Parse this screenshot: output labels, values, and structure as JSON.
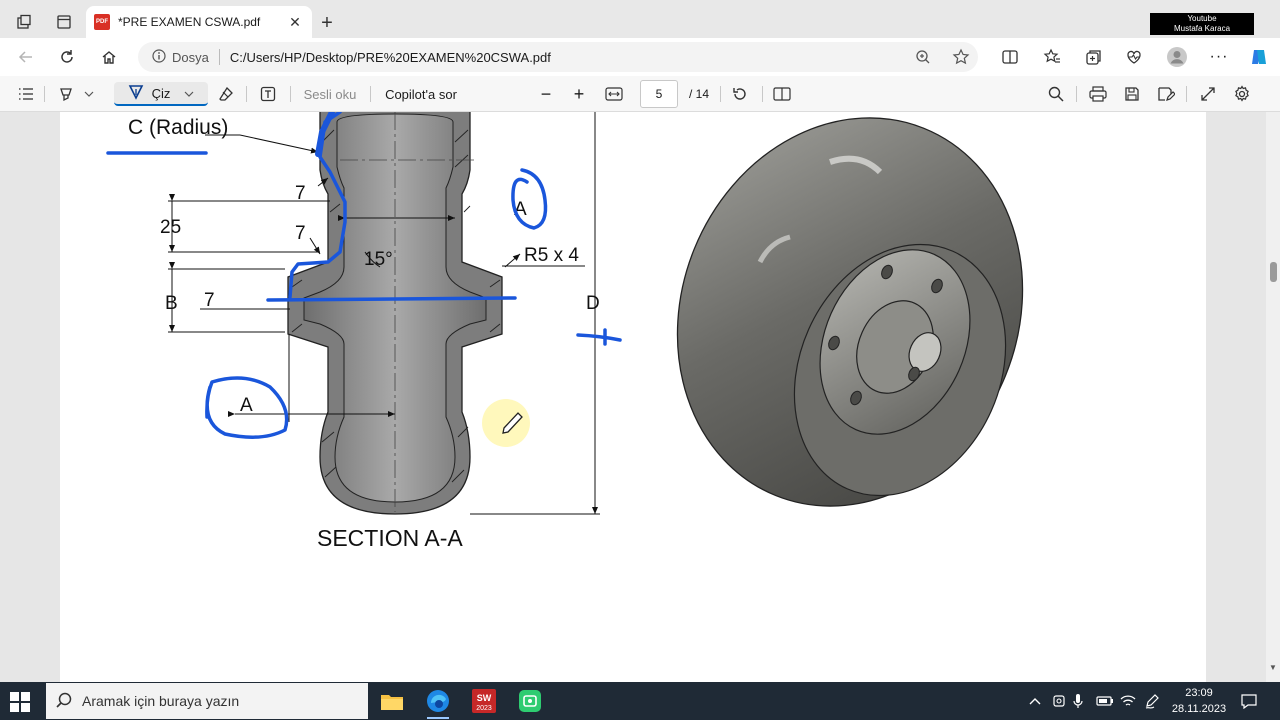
{
  "tab": {
    "title": "*PRE EXAMEN CSWA.pdf",
    "badge": "PDF"
  },
  "overlay": {
    "line1": "Youtube",
    "line2": "Mustafa Karaca"
  },
  "address": {
    "label": "Dosya",
    "url": "C:/Users/HP/Desktop/PRE%20EXAMEN%20CSWA.pdf"
  },
  "pdf_toolbar": {
    "draw_label": "Çiz",
    "read_aloud_label": "Sesli oku",
    "copilot_label": "Copilot'a sor",
    "current_page": "5",
    "total_pages": "/ 14"
  },
  "drawing": {
    "radius_label": "C (Radius)",
    "dim_7_top": "7",
    "dim_25": "25",
    "dim_7_mid": "7",
    "angle": "15°",
    "fillet": "R5 x 4",
    "dim_B": "B",
    "dim_7_low": "7",
    "dim_D": "D",
    "dim_A_right": "A",
    "dim_A_left": "A",
    "section_title": "SECTION A-A"
  },
  "taskbar": {
    "search_placeholder": "Aramak için buraya yazın",
    "time": "23:09",
    "date": "28.11.2023",
    "sw_label": "2023"
  },
  "colors": {
    "accent": "#0067c0",
    "ink_blue": "#1a56db",
    "taskbar": "#1f2a36"
  }
}
